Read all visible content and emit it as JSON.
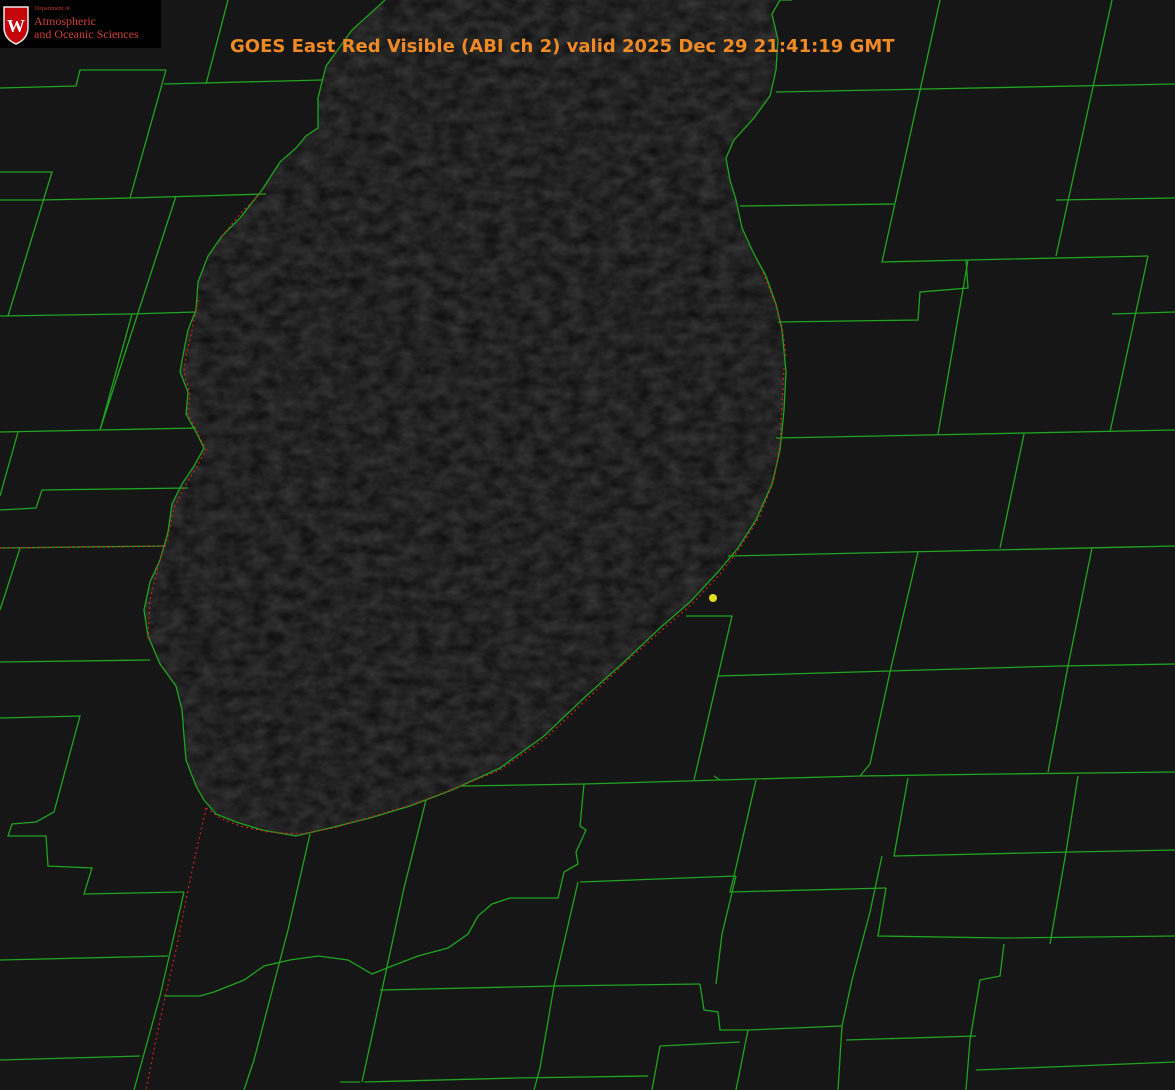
{
  "title": "GOES East Red Visible (ABI ch 2) valid 2025 Dec 29 21:41:19 GMT",
  "logo": {
    "department": "Department of",
    "line1": "Atmospheric",
    "line2": "and Oceanic Sciences",
    "crest_letter": "W"
  },
  "colors": {
    "background": "#141414",
    "lake": "#0b0b0b",
    "county_lines": "#1fa51f",
    "state_line": "#d02020",
    "title": "#f08a24",
    "marker": "#e3dd1c"
  },
  "layers": [
    "satellite-visible",
    "county-boundaries",
    "state-boundaries",
    "lakeshore"
  ],
  "marker": {
    "icon": "station-dot-icon"
  }
}
